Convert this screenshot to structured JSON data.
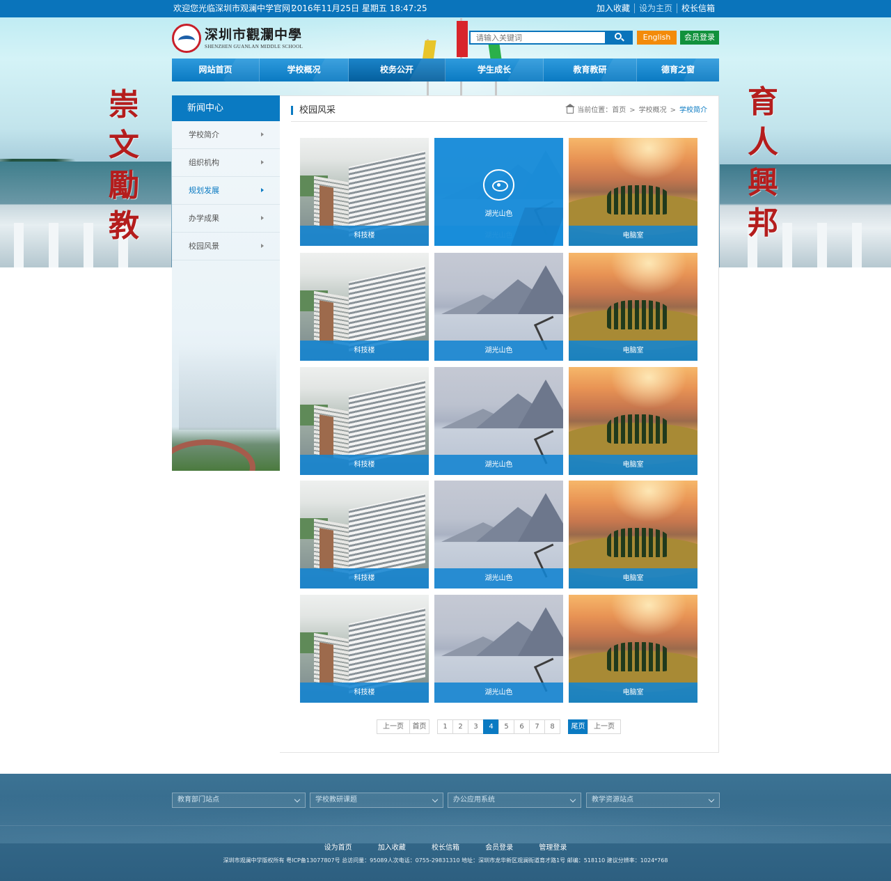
{
  "topbar": {
    "welcome": "欢迎您光临深圳市观澜中学官网！",
    "date": "2016年11月25日   星期五 18:47:25",
    "links": [
      "加入收藏",
      "设为主页",
      "校长信箱"
    ]
  },
  "header": {
    "school_name_cn": "深圳市觀瀾中學",
    "school_name_en": "SHENZHEN GUANLAN MIDDLE SCHOOL",
    "search_placeholder": "请输入关键词",
    "english_label": "English",
    "login_label": "会员登录"
  },
  "motto": {
    "left": [
      "崇",
      "文",
      "勵",
      "教"
    ],
    "right": [
      "育",
      "人",
      "興",
      "邦"
    ]
  },
  "nav": {
    "items": [
      "网站首页",
      "学校概况",
      "校务公开",
      "学生成长",
      "教育教研",
      "德育之窗"
    ],
    "active_index": 2
  },
  "sidebar": {
    "title": "新闻中心",
    "items": [
      "学校简介",
      "组织机构",
      "规划发展",
      "办学成果",
      "校园风景"
    ],
    "active_index": 2
  },
  "content": {
    "section_title": "校园风采",
    "breadcrumb": {
      "prefix": "当前位置：",
      "path": [
        "首页",
        "学校概况",
        "学校简介"
      ]
    },
    "gallery": [
      [
        "科技楼",
        "湖光山色",
        "电脑室"
      ],
      [
        "科技楼",
        "湖光山色",
        "电脑室"
      ],
      [
        "科技楼",
        "湖光山色",
        "电脑室"
      ],
      [
        "科技楼",
        "湖光山色",
        "电脑室"
      ],
      [
        "科技楼",
        "湖光山色",
        "电脑室"
      ]
    ],
    "hovered_card": "湖光山色"
  },
  "pager": {
    "prev": "上一页",
    "first": "首页",
    "pages": [
      "1",
      "2",
      "3",
      "4",
      "5",
      "6",
      "7",
      "8"
    ],
    "current": "4",
    "last": "尾页",
    "next": "上一页"
  },
  "footer": {
    "selects": [
      "教育部门站点",
      "学校教研课题",
      "办公应用系统",
      "教学资源站点"
    ],
    "links": [
      "设为首页",
      "加入收藏",
      "校长信箱",
      "会员登录",
      "管理登录"
    ],
    "copyright": "深圳市观澜中学版权所有 粤ICP备13077807号 总访问量：95089人次电话：0755-29831310 地址：深圳市龙华新区观澜街道育才路1号 邮编：518110 建议分辨率：1024*768"
  },
  "colors": {
    "primary": "#0a7ac2",
    "english_button": "#f38b0a",
    "login_button": "#11913c",
    "motto": "#b41d1d"
  }
}
